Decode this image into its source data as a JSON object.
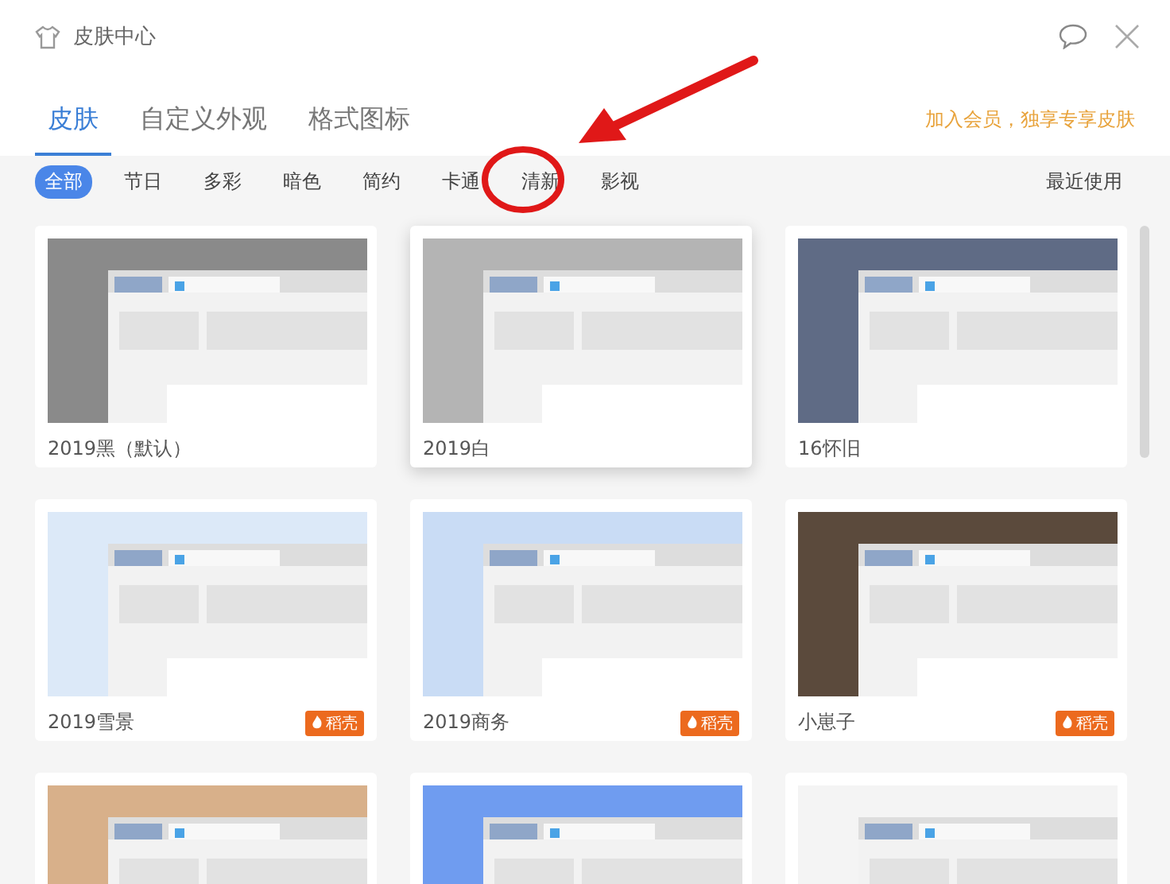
{
  "window": {
    "title": "皮肤中心"
  },
  "tabs": [
    {
      "label": "皮肤",
      "selected": true
    },
    {
      "label": "自定义外观",
      "selected": false
    },
    {
      "label": "格式图标",
      "selected": false
    }
  ],
  "member_link": "加入会员，独享专享皮肤",
  "filters": [
    {
      "label": "全部",
      "selected": true
    },
    {
      "label": "节日",
      "selected": false
    },
    {
      "label": "多彩",
      "selected": false
    },
    {
      "label": "暗色",
      "selected": false
    },
    {
      "label": "简约",
      "selected": false
    },
    {
      "label": "卡通",
      "selected": false
    },
    {
      "label": "清新",
      "selected": false
    },
    {
      "label": "影视",
      "selected": false
    }
  ],
  "recent": "最近使用",
  "skins": [
    {
      "name": "2019黑（默认）",
      "color": "#8a8a8a",
      "selected": false
    },
    {
      "name": "2019白",
      "color": "#b4b4b4",
      "selected": true
    },
    {
      "name": "16怀旧",
      "color": "#5f6b85",
      "selected": false
    },
    {
      "name": "2019雪景",
      "color": "#dce9f8",
      "selected": false,
      "badge": "稻壳"
    },
    {
      "name": "2019商务",
      "color": "#c9dcf5",
      "selected": false,
      "badge": "稻壳"
    },
    {
      "name": "小崽子",
      "color": "#5b4a3c",
      "selected": false,
      "badge": "稻壳"
    },
    {
      "color": "#d8b08a",
      "selected": false
    },
    {
      "color": "#6f9cf0",
      "selected": false
    },
    {
      "color": "#f4f4f4",
      "selected": false
    }
  ]
}
